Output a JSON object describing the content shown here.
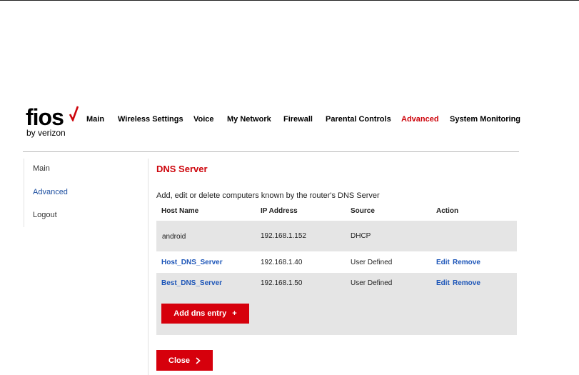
{
  "brand": {
    "word": "fios",
    "sub": "by verizon",
    "accent": "#cd040b"
  },
  "nav": {
    "items": [
      "Main",
      "Wireless Settings",
      "Voice",
      "My Network",
      "Firewall",
      "Parental Controls",
      "Advanced",
      "System Monitoring"
    ],
    "active": "Advanced"
  },
  "sidebar": {
    "items": [
      "Main",
      "Advanced",
      "Logout"
    ],
    "active": "Advanced"
  },
  "page": {
    "title": "DNS Server",
    "description": "Add, edit or delete computers known by the router's DNS Server"
  },
  "table": {
    "headers": [
      "Host Name",
      "IP Address",
      "Source",
      "Action"
    ],
    "rows": [
      {
        "host": "android",
        "ip": "192.168.1.152",
        "source": "DHCP",
        "actions": []
      },
      {
        "host": "Host_DNS_Server",
        "ip": "192.168.1.40",
        "source": "User Defined",
        "actions": [
          "Edit",
          "Remove"
        ]
      },
      {
        "host": "Best_DNS_Server",
        "ip": "192.168.1.50",
        "source": "User Defined",
        "actions": [
          "Edit",
          "Remove"
        ]
      }
    ]
  },
  "buttons": {
    "add": "Add dns entry",
    "add_icon": "plus-icon",
    "close": "Close",
    "close_icon": "chevron-right-icon"
  }
}
